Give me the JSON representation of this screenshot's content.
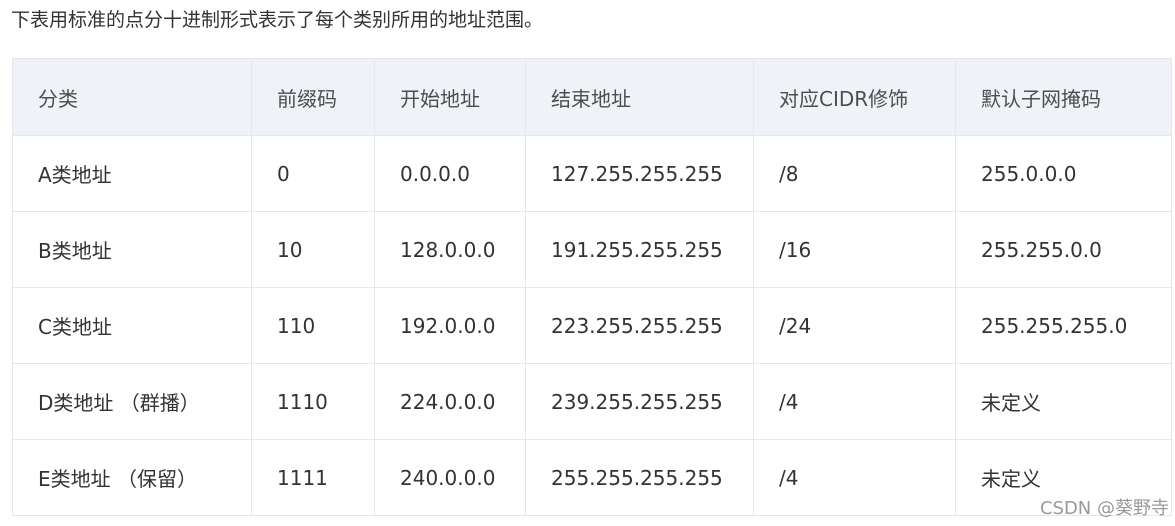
{
  "intro_text": "下表用标准的点分十进制形式表示了每个类别所用的地址范围。",
  "table": {
    "headers": [
      "分类",
      "前缀码",
      "开始地址",
      "结束地址",
      "对应CIDR修饰",
      "默认子网掩码"
    ],
    "rows": [
      [
        "A类地址",
        "0",
        "0.0.0.0",
        "127.255.255.255",
        "/8",
        "255.0.0.0"
      ],
      [
        "B类地址",
        "10",
        "128.0.0.0",
        "191.255.255.255",
        "/16",
        "255.255.0.0"
      ],
      [
        "C类地址",
        "110",
        "192.0.0.0",
        "223.255.255.255",
        "/24",
        "255.255.255.0"
      ],
      [
        "D类地址 （群播）",
        "1110",
        "224.0.0.0",
        "239.255.255.255",
        "/4",
        "未定义"
      ],
      [
        "E类地址 （保留）",
        "1111",
        "240.0.0.0",
        "255.255.255.255",
        "/4",
        "未定义"
      ]
    ]
  },
  "watermark": "CSDN @葵野寺"
}
